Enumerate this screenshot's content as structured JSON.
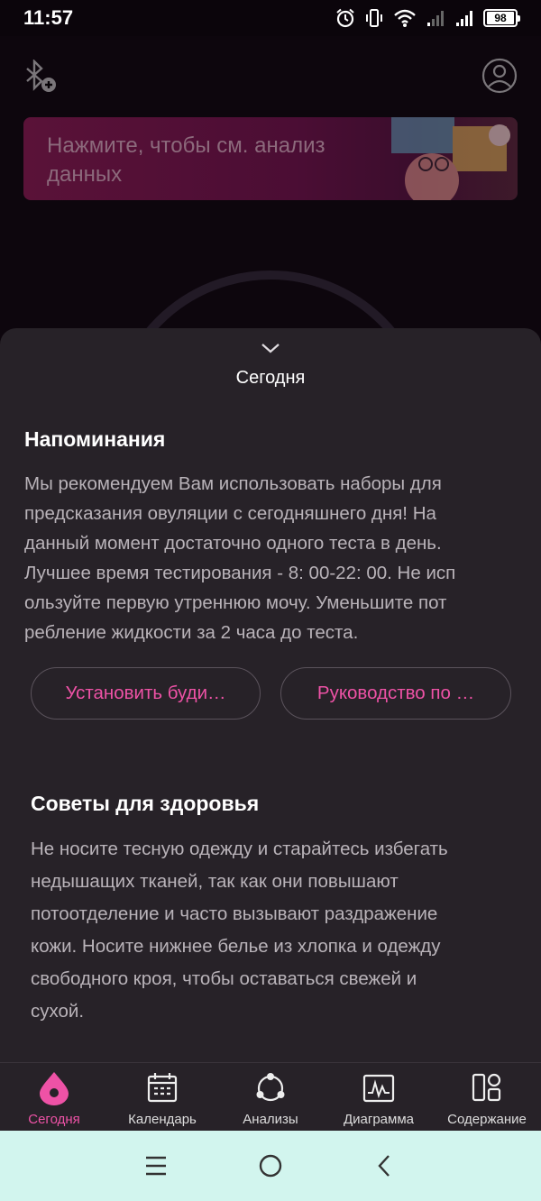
{
  "status": {
    "time": "11:57",
    "battery": "98"
  },
  "banner": {
    "text": "Нажмите, чтобы см. анализ данных"
  },
  "sheet": {
    "title": "Сегодня",
    "reminders": {
      "heading": "Напоминания",
      "body": "Мы рекомендуем Вам использовать наборы для\n предсказания овуляции с сегодняшнего дня! На\nданный момент достаточно одного теста в день.\nЛучшее время тестирования - 8: 00-22: 00. Не исп\nользуйте первую утреннюю мочу. Уменьшите пот\nребление жидкости за 2 часа до теста."
    },
    "buttons": {
      "alarm": "Установить буди…",
      "guide": "Руководство по …"
    },
    "tips": {
      "heading": "Советы для здоровья",
      "body": "Не носите тесную одежду и старайтесь избегать\nнедышащих тканей, так как они повышают\nпотоотделение и часто вызывают раздражение\nкожи. Носите нижнее белье из хлопка и одежду\nсвободного кроя, чтобы оставаться свежей и\nсухой."
    }
  },
  "nav": {
    "items": [
      {
        "label": "Сегодня",
        "icon": "today-drop-icon",
        "active": true
      },
      {
        "label": "Календарь",
        "icon": "calendar-icon",
        "active": false
      },
      {
        "label": "Анализы",
        "icon": "analysis-cycle-icon",
        "active": false
      },
      {
        "label": "Диаграмма",
        "icon": "chart-icon",
        "active": false
      },
      {
        "label": "Содержание",
        "icon": "content-grid-icon",
        "active": false
      }
    ]
  },
  "colors": {
    "accent": "#ee52a6",
    "sheet": "#272228",
    "system_nav": "#d2f5ee"
  }
}
